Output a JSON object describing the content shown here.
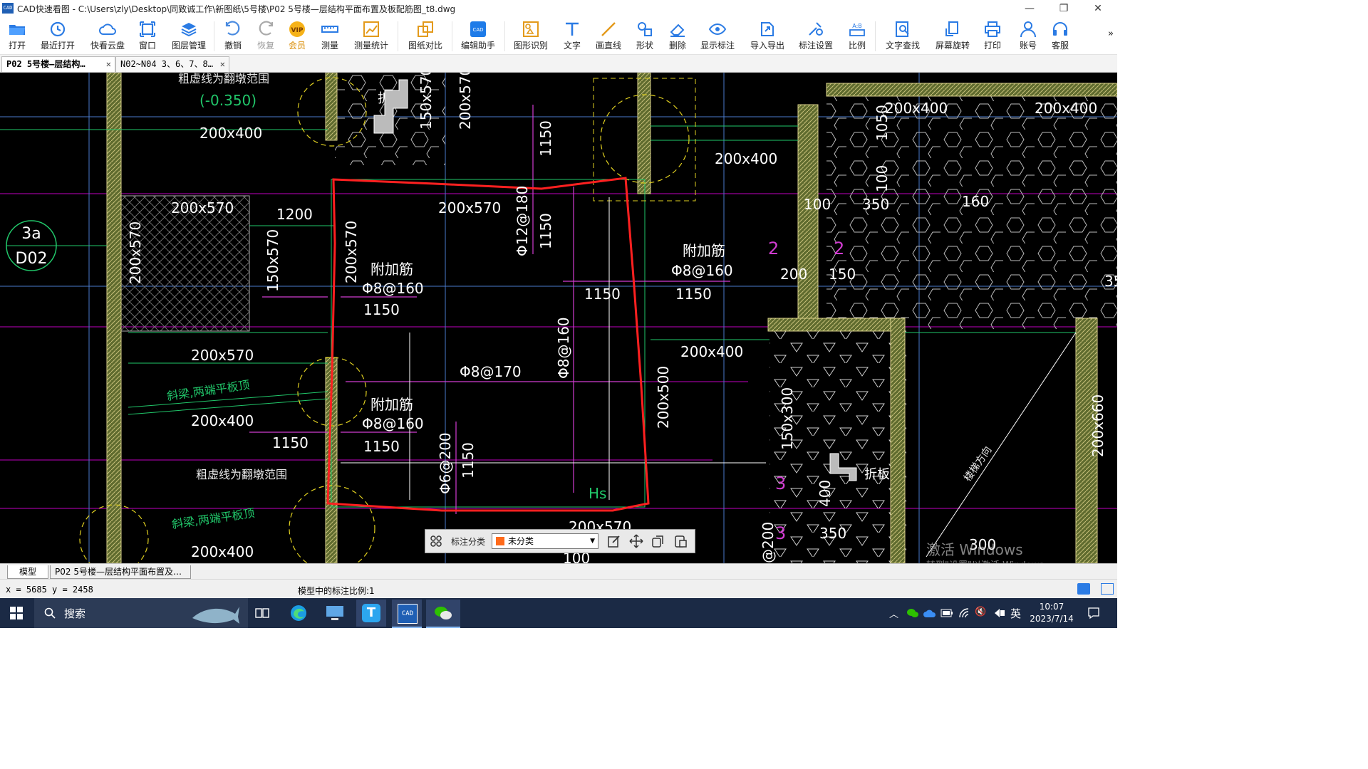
{
  "window": {
    "app_icon_text": "CAD",
    "title": "CAD快速看图 - C:\\Users\\zly\\Desktop\\同致诚工作\\新图纸\\5号楼\\P02 5号楼—层结构平面布置及板配筋图_t8.dwg",
    "minimize": "—",
    "restore": "❐",
    "close": "✕"
  },
  "toolbar": [
    {
      "id": "open",
      "label": "打开",
      "icon": "folder-icon"
    },
    {
      "id": "recent",
      "label": "最近打开",
      "icon": "clock-icon"
    },
    {
      "id": "cloud",
      "label": "快看云盘",
      "icon": "cloud-icon"
    },
    {
      "id": "window",
      "label": "窗口",
      "icon": "window-icon"
    },
    {
      "id": "layers",
      "label": "图层管理",
      "icon": "layers-icon"
    },
    {
      "id": "undo",
      "label": "撤销",
      "icon": "undo-icon"
    },
    {
      "id": "redo",
      "label": "恢复",
      "icon": "redo-icon"
    },
    {
      "id": "vip",
      "label": "会员",
      "icon": "vip-icon",
      "badge": "VIP"
    },
    {
      "id": "measure",
      "label": "测量",
      "icon": "ruler-icon"
    },
    {
      "id": "measure_stats",
      "label": "测量统计",
      "icon": "chart-icon"
    },
    {
      "id": "compare",
      "label": "图纸对比",
      "icon": "compare-icon"
    },
    {
      "id": "edit_helper",
      "label": "编辑助手",
      "icon": "edit-helper-icon"
    },
    {
      "id": "shape_recog",
      "label": "图形识别",
      "icon": "shape-recog-icon"
    },
    {
      "id": "text",
      "label": "文字",
      "icon": "text-icon"
    },
    {
      "id": "line",
      "label": "画直线",
      "icon": "line-icon"
    },
    {
      "id": "shape",
      "label": "形状",
      "icon": "shape-icon"
    },
    {
      "id": "delete",
      "label": "删除",
      "icon": "eraser-icon"
    },
    {
      "id": "show_anno",
      "label": "显示标注",
      "icon": "eye-icon"
    },
    {
      "id": "import_export",
      "label": "导入导出",
      "icon": "export-icon"
    },
    {
      "id": "anno_settings",
      "label": "标注设置",
      "icon": "settings-icon"
    },
    {
      "id": "scale",
      "label": "比例",
      "icon": "scale-icon"
    },
    {
      "id": "text_search",
      "label": "文字查找",
      "icon": "text-search-icon"
    },
    {
      "id": "rotate",
      "label": "屏幕旋转",
      "icon": "rotate-icon"
    },
    {
      "id": "print",
      "label": "打印",
      "icon": "print-icon"
    },
    {
      "id": "account",
      "label": "账号",
      "icon": "user-icon"
    },
    {
      "id": "service",
      "label": "客服",
      "icon": "headset-icon"
    }
  ],
  "toolbar_more": "»",
  "tabs": [
    {
      "label": "P02 5号楼—层结构…",
      "close": "✕",
      "active": true
    },
    {
      "label": "N02~N04 3、6、7、8…",
      "close": "✕",
      "active": false
    }
  ],
  "drawing": {
    "axis_bubble": [
      "3a",
      "D02"
    ],
    "labels_white": [
      "200x400",
      "200x570",
      "1200",
      "200x570",
      "150x570",
      "200x570",
      "1150",
      "200x570",
      "200x400",
      "1150",
      "1150",
      "200x570",
      "1150",
      "1150",
      "200x400",
      "200x500",
      "200x400",
      "200x400",
      "100",
      "350",
      "100",
      "1050",
      "200",
      "150",
      "160",
      "200x400",
      "150x300",
      "400",
      "350",
      "200x660",
      "200x570",
      "200x400",
      "200x570",
      "Φ8@170",
      "Φ8@160",
      "Φ12@180",
      "Φ8@160",
      "Φ8@160",
      "Φ8@160",
      "Φ6@200",
      "1150",
      "附加筋",
      "附加筋",
      "附加筋",
      "150x570",
      "1150",
      "1150",
      "2",
      "2",
      "3",
      "3",
      "折板",
      "折板",
      "300",
      "35",
      "@200",
      "100"
    ],
    "labels_green": [
      "(-0.350)",
      "斜梁,两端平板顶",
      "斜梁,两端平板顶",
      "Hs"
    ],
    "labels_note": [
      "粗虚线为翻墩范围",
      "粗虚线为翻墩范围",
      "楼梯方向"
    ]
  },
  "float_toolbar": {
    "label": "标注分类",
    "selected": "未分类",
    "swatch_color": "#ff6a1a",
    "buttons": [
      "edit-annotation-icon",
      "move-icon",
      "copy-icon",
      "paste-icon"
    ]
  },
  "layout_tabs": [
    "模型",
    "P02 5号楼—层结构平面布置及…"
  ],
  "status": {
    "coords": "x = 5685  y = 2458",
    "scale_text": "模型中的标注比例:1"
  },
  "watermark": {
    "line1": "激活 Windows",
    "line2": "转到\"设置\"以激活 Windows。"
  },
  "taskbar": {
    "search": "搜索",
    "ime": "英",
    "time": "10:07",
    "date": "2023/7/14"
  }
}
